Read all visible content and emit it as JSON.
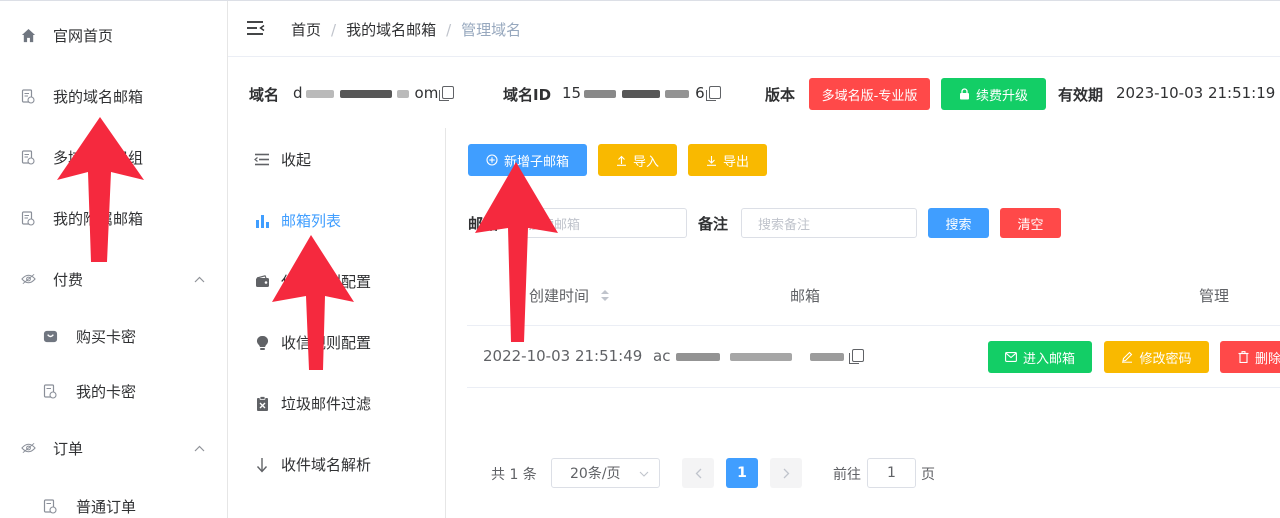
{
  "sidebar": {
    "items": [
      {
        "label": "官网首页",
        "icon": "home-icon"
      },
      {
        "label": "我的域名邮箱",
        "icon": "doc-icon"
      },
      {
        "label": "多域名付费组",
        "icon": "doc-icon"
      },
      {
        "label": "我的附属邮箱",
        "icon": "doc-icon"
      },
      {
        "label": "付费",
        "icon": "eye-icon"
      },
      {
        "label": "购买卡密",
        "icon": "bag-icon"
      },
      {
        "label": "我的卡密",
        "icon": "doc-icon"
      },
      {
        "label": "订单",
        "icon": "eye-icon"
      },
      {
        "label": "普通订单",
        "icon": "doc-icon"
      }
    ]
  },
  "breadcrumb": [
    "首页",
    "我的域名邮箱",
    "管理域名"
  ],
  "info": {
    "domain_label": "域名",
    "domain_value_start": "d",
    "domain_value_end": "om",
    "domain_id_label": "域名ID",
    "domain_id_start": "15",
    "domain_id_end": "6",
    "version_label": "版本",
    "version_value": "多域名版-专业版",
    "renew_button": "续费升级",
    "expiry_label": "有效期",
    "expiry_value": "2023-10-03 21:51:19"
  },
  "menu2": [
    {
      "label": "收起",
      "icon": "collapse-icon"
    },
    {
      "label": "邮箱列表",
      "icon": "bar-chart-icon",
      "active": true
    },
    {
      "label": "代收规则配置",
      "icon": "wallet-icon"
    },
    {
      "label": "收信规则配置",
      "icon": "bulb-icon"
    },
    {
      "label": "垃圾邮件过滤",
      "icon": "clipboard-x-icon"
    },
    {
      "label": "收件域名解析",
      "icon": "arrow-down-icon"
    }
  ],
  "toolbar": {
    "add_button": "新增子邮箱",
    "import_button": "导入",
    "export_button": "导出"
  },
  "filters": {
    "email_label": "邮箱",
    "email_placeholder": "搜索邮箱",
    "note_label": "备注",
    "note_placeholder": "搜索备注",
    "search_button": "搜索",
    "clear_button": "清空"
  },
  "table": {
    "headers": [
      "创建时间",
      "邮箱",
      "管理"
    ],
    "rows": [
      {
        "created": "2022-10-03 21:51:49",
        "email_start": "ac",
        "actions": [
          "进入邮箱",
          "修改密码",
          "删除"
        ]
      }
    ]
  },
  "pagination": {
    "total": "共 1 条",
    "page_size": "20条/页",
    "current": "1",
    "goto_label": "前往",
    "goto_value": "1",
    "goto_suffix": "页"
  },
  "colors": {
    "primary": "#409eff",
    "warning": "#f9b900",
    "success": "#13ce66",
    "danger": "#ff4949",
    "annotation": "#f5293e"
  }
}
